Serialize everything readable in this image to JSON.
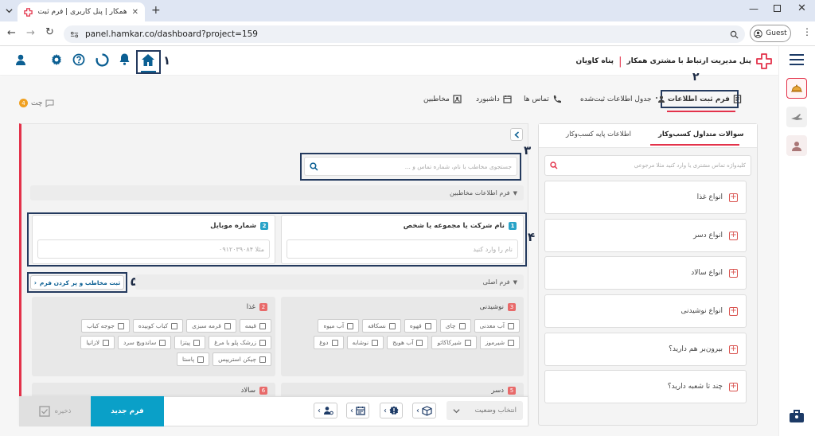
{
  "browser": {
    "tab_title": "همکار | پنل کاربری | فرم ثبت اطلاعات",
    "url": "panel.hamkar.co/dashboard?project=159",
    "profile_label": "Guest"
  },
  "header": {
    "brand_title": "پنل مدیریت ارتباط با مشتری همکار",
    "brand_separator": "|",
    "user_name": "پناه کاویان",
    "accent_color": "#e3324a",
    "primary_color": "#0b5f93"
  },
  "annotations": {
    "n1": "۱",
    "n2": "۲",
    "n3": "۳",
    "n4": "۴",
    "n5": "۵"
  },
  "chat": {
    "label": "چت",
    "count": "4"
  },
  "nav_tabs": [
    {
      "label": "فرم ثبت اطلاعات",
      "icon": "form-icon"
    },
    {
      "label": "جدول اطلاعات ثبت‌شده",
      "icon": "users-table-icon"
    },
    {
      "label": "تماس ها",
      "icon": "phone-icon"
    },
    {
      "label": "داشبورد",
      "icon": "calendar-icon"
    },
    {
      "label": "مخاطبین",
      "icon": "contacts-icon"
    }
  ],
  "right_panel": {
    "tabs": [
      "سوالات متداول کسب‌وکار",
      "اطلاعات پایه کسب‌وکار"
    ],
    "search_placeholder": "کلیدواژه تماس مشتری یا وارد کنید مثلا مرجوعی",
    "questions": [
      "انواع غذا",
      "انواع دسر",
      "انواع سالاد",
      "انواع نوشیدنی",
      "بیرون‌بر هم دارید؟",
      "چند تا شعبه دارید؟"
    ]
  },
  "form": {
    "search_placeholder": "جستجوی مخاطب با نام، شماره تماس و ...",
    "contacts_section": "فرم اطلاعات مخاطبین",
    "field1": {
      "index": "1",
      "label": "نام شرکت یا مجموعه یا شخص",
      "placeholder": "نام را وارد کنید"
    },
    "field2": {
      "index": "2",
      "label": "شماره موبایل",
      "placeholder": "مثلا ۰۹۱۲۰۳۹۰۸۴"
    },
    "submit_label": "ثبت مخاطب و پر کردن فرم",
    "main_section": "فرم اصلی",
    "group_drinks": {
      "index": "3",
      "title": "نوشیدنی",
      "options": [
        "آب معدنی",
        "چای",
        "قهوه",
        "نسکافه",
        "آب میوه",
        "شیرموز",
        "شیرکاکائو",
        "آب هویج",
        "نوشابه",
        "دوغ"
      ]
    },
    "group_food": {
      "index": "2",
      "title": "غذا",
      "options": [
        "قیمه",
        "قرمه سبزی",
        "کباب کوبیده",
        "جوجه کباب",
        "زرشک پلو با مرغ",
        "پیتزا",
        "ساندویچ سرد",
        "لازانیا",
        "چیکن استریپس",
        "پاستا"
      ]
    },
    "group_dessert": {
      "index": "5",
      "title": "دسر"
    },
    "group_salad": {
      "index": "6",
      "title": "سالاد"
    }
  },
  "footer": {
    "save_label": "ذخیره",
    "new_form_label": "فرم جدید",
    "status_placeholder": "انتخاب وضعیت"
  }
}
